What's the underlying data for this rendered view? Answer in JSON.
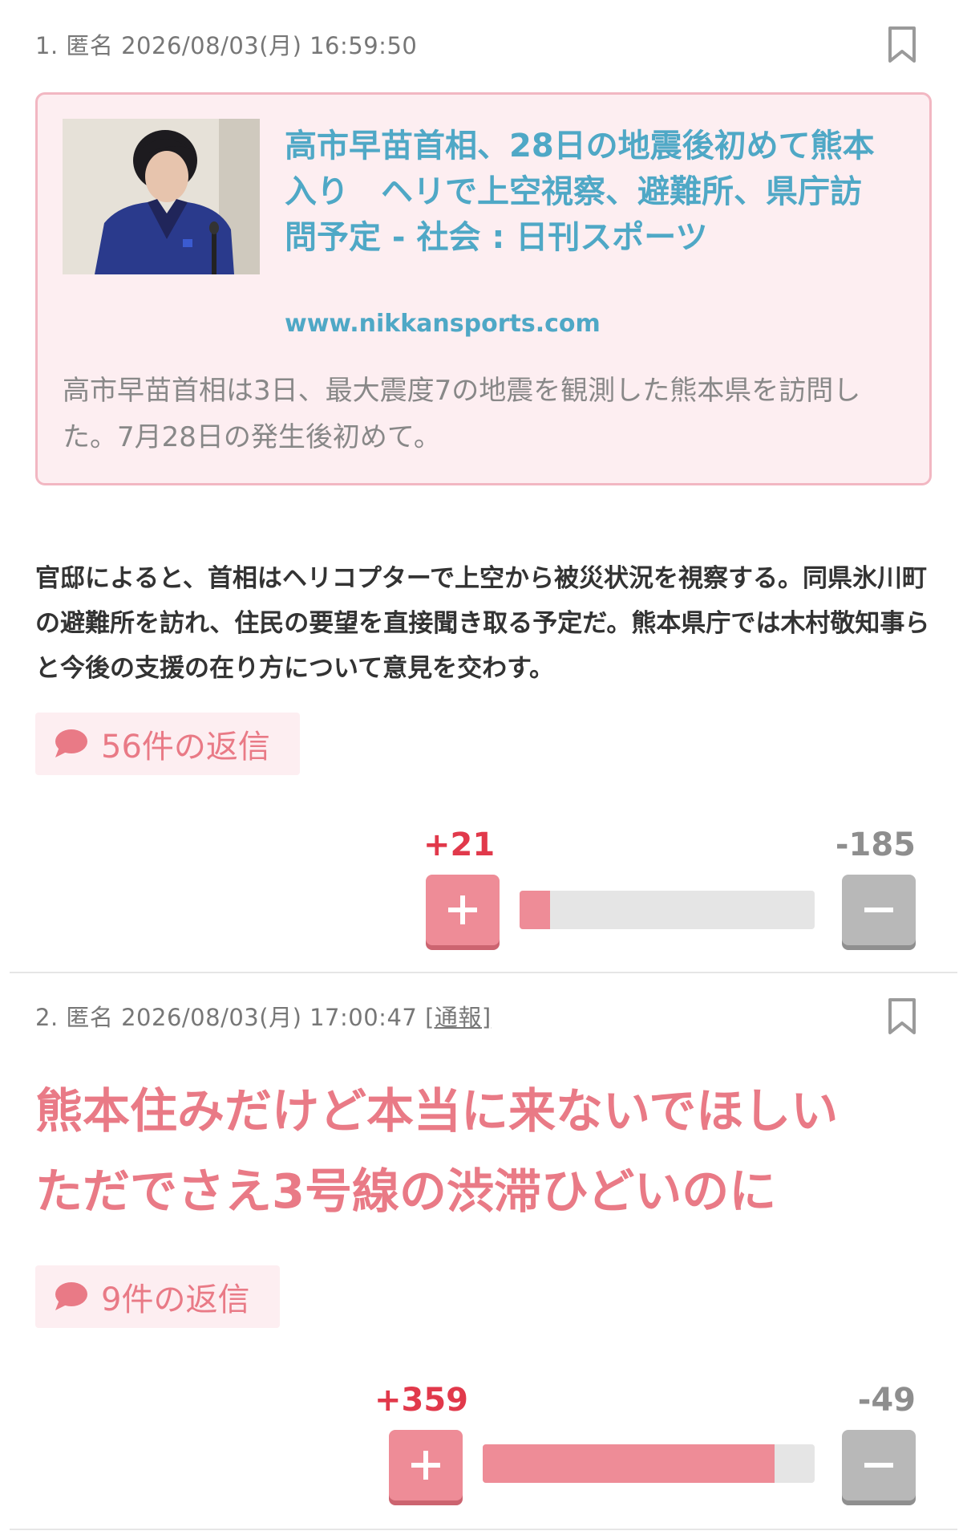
{
  "comments": [
    {
      "meta": "1. 匿名 2026/08/03(月) 16:59:50",
      "link_card": {
        "title": "高市早苗首相、28日の地震後初めて熊本入り　ヘリで上空視察、避難所、県庁訪問予定 - 社会 : 日刊スポーツ",
        "domain": "www.nikkansports.com",
        "description": "高市早苗首相は3日、最大震度7の地震を観測した熊本県を訪問した。7月28日の発生後初めて。"
      },
      "body": "官邸によると、首相はヘリコプターで上空から被災状況を視察する。同県氷川町の避難所を訪れ、住民の要望を直接聞き取る予定だ。熊本県庁では木村敬知事らと今後の支援の在り方について意見を交わす。",
      "reply_label": "56件の返信",
      "plus": "+21",
      "minus": "-185",
      "plus_ratio": 0.102
    },
    {
      "meta": "2. 匿名 2026/08/03(月) 17:00:47",
      "report_label": "[通報]",
      "body_line1": "熊本住みだけど本当に来ないでほしい",
      "body_line2": "ただでさえ3号線の渋滞ひどいのに",
      "reply_label": "9件の返信",
      "plus": "+359",
      "minus": "-49",
      "plus_ratio": 0.88
    }
  ],
  "colors": {
    "accent_pink": "#e97a86",
    "link_blue": "#4fa8c6",
    "plus_red": "#e1394b",
    "minus_gray": "#8e8e8e",
    "card_bg": "#fdeef1"
  },
  "icons": [
    "bookmark-icon",
    "speech-bubble-icon",
    "plus-icon",
    "minus-icon"
  ]
}
